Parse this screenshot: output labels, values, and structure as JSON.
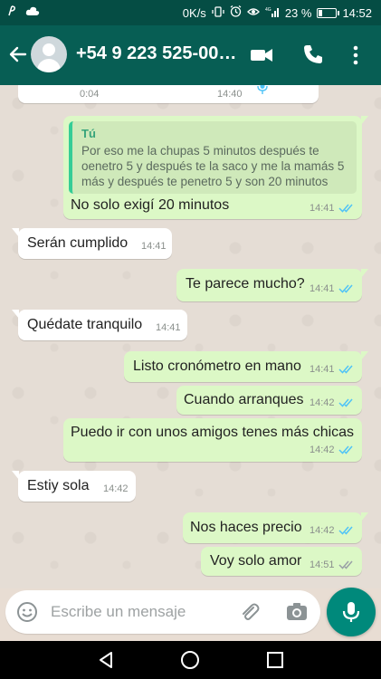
{
  "status_bar": {
    "carrier_icon": "signal-p-icon",
    "network_speed": "0K/s",
    "battery_percent_text": "23 %",
    "battery_level": 0.23,
    "time": "14:52"
  },
  "header": {
    "contact_name": "+54 9 223 525-00…"
  },
  "chat": {
    "partial_top": {
      "time_a": "0:04",
      "time_b": "14:40"
    },
    "quoted": {
      "author": "Tú",
      "text": "Por eso me la chupas 5 minutos después te oenetro 5 y después te la saco y me la mamás 5 más y después te penetro 5 y son 20 minutos"
    },
    "messages": [
      {
        "dir": "out",
        "text": "No solo exigí 20 minutos",
        "time": "14:41",
        "status": "read"
      },
      {
        "dir": "in",
        "text": "Serán cumplido",
        "time": "14:41"
      },
      {
        "dir": "out",
        "text": "Te parece mucho?",
        "time": "14:41",
        "status": "read"
      },
      {
        "dir": "in",
        "text": "Quédate tranquilo",
        "time": "14:41"
      },
      {
        "dir": "out",
        "text": "Listo cronómetro en mano",
        "time": "14:41",
        "status": "read"
      },
      {
        "dir": "out",
        "text": "Cuando arranques",
        "time": "14:42",
        "status": "read"
      },
      {
        "dir": "out",
        "text": "Puedo ir con unos amigos tenes más chicas",
        "time": "14:42",
        "status": "read"
      },
      {
        "dir": "in",
        "text": "Estiy sola",
        "time": "14:42"
      },
      {
        "dir": "out",
        "text": "Nos haces precio",
        "time": "14:42",
        "status": "read"
      },
      {
        "dir": "out",
        "text": "Voy solo amor",
        "time": "14:51",
        "status": "delivered"
      }
    ]
  },
  "composer": {
    "placeholder": "Escribe un mensaje"
  },
  "colors": {
    "header": "#075e54",
    "status_bar": "#054d44",
    "outgoing_bubble": "#dcf8c6",
    "incoming_bubble": "#ffffff",
    "read_ticks": "#4fc3f7",
    "delivered_ticks": "#9aa0a6",
    "mic_button": "#00897b"
  }
}
